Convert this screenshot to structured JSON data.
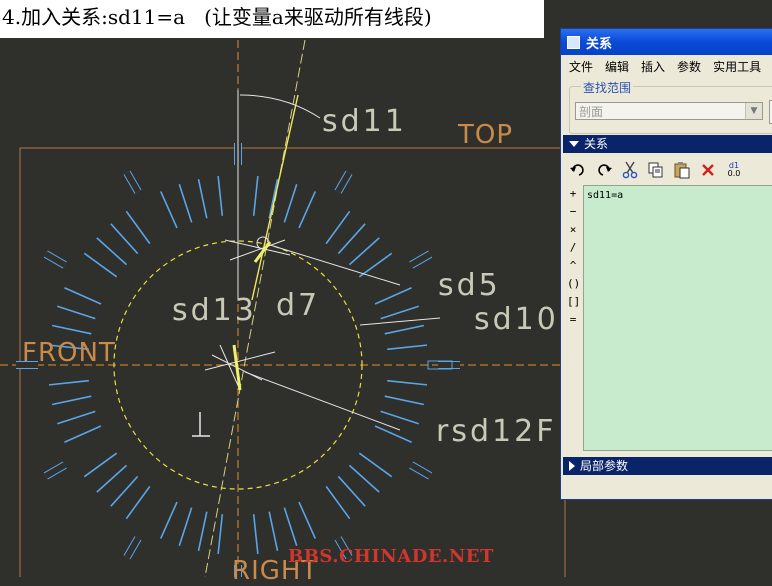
{
  "caption": "4.加入关系:sd11=a   (让变量a来驱动所有线段)",
  "cad": {
    "dims": {
      "sd11": "sd11",
      "sd5": "sd5",
      "sd10": "sd10",
      "sd13": "sd13",
      "d7": "d7",
      "sd12": "rsd12",
      "sd12_suffix": "F"
    },
    "planes": {
      "top": "TOP",
      "front": "FRONT",
      "right": "RIGHT"
    }
  },
  "watermark": "BBS.CHINADE.NET",
  "dialog": {
    "title": "关系",
    "menu": [
      "文件",
      "编辑",
      "插入",
      "参数",
      "实用工具"
    ],
    "scope_label": "查找范围",
    "scope_value": "剖面",
    "section_relations": "关系",
    "section_local_params": "局部参数",
    "toolbar": [
      "undo-icon",
      "redo-icon",
      "cut-icon",
      "copy-icon",
      "paste-icon",
      "delete-icon",
      "dimension-toggle-icon"
    ],
    "toolbar_dim_label": "d1",
    "toolbar_dim_sub": "0.0",
    "operators": [
      "+",
      "−",
      "×",
      "/",
      "^",
      "()",
      "[]",
      "="
    ],
    "editor_text": "sd11=a"
  },
  "colors": {
    "background": "#2f2f2c",
    "editor_bg": "#c7ebcc",
    "tick": "#5aa5e8",
    "circle": "#e8e040",
    "centerline": "#e3902a",
    "dim_line": "#e6e6e6"
  }
}
